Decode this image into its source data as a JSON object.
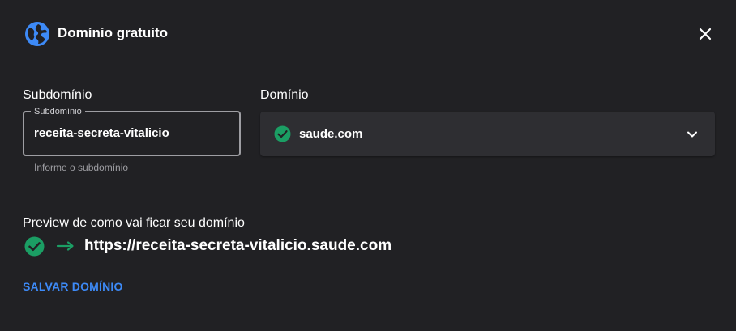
{
  "dialog": {
    "title": "Domínio gratuito",
    "icon": "globe-icon",
    "close_icon": "close-icon"
  },
  "subdomain": {
    "section_label": "Subdomínio",
    "field_label": "Subdomínio",
    "value": "receita-secreta-vitalicio",
    "helper": "Informe o subdomínio"
  },
  "domain": {
    "section_label": "Domínio",
    "selected": "saude.com",
    "status_icon": "check-circle-icon",
    "chevron_icon": "chevron-down-icon"
  },
  "preview": {
    "label": "Preview de como vai ficar seu domínio",
    "url": "https://receita-secreta-vitalicio.saude.com",
    "status_icon": "check-circle-icon",
    "arrow_icon": "arrow-right-icon"
  },
  "actions": {
    "save_label": "SALVAR DOMÍNIO"
  },
  "colors": {
    "background": "#212124",
    "accent": "#3d8af7",
    "success": "#1b9e64",
    "field_border": "#9e9ea3",
    "select_bg": "#2e2e32"
  }
}
